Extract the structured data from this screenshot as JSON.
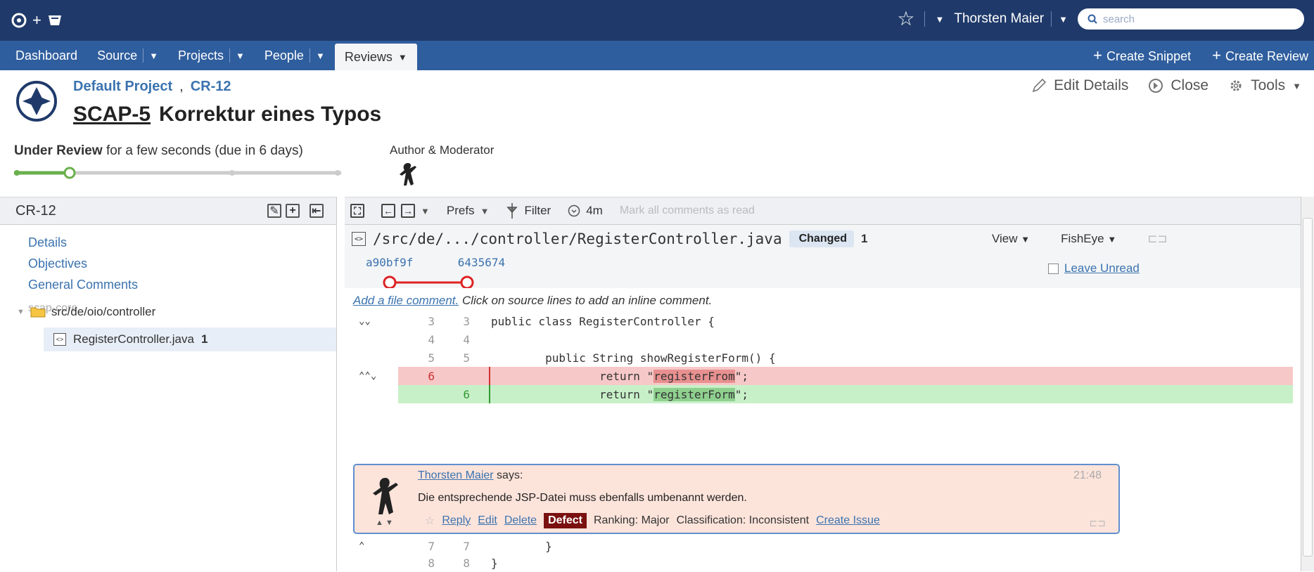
{
  "topbar": {
    "user_name": "Thorsten Maier",
    "search_placeholder": "search"
  },
  "nav": {
    "items": [
      "Dashboard",
      "Source",
      "Projects",
      "People",
      "Reviews"
    ],
    "create_snippet": "Create Snippet",
    "create_review": "Create Review"
  },
  "header": {
    "project": "Default Project",
    "review_id": "CR-12",
    "issue_key": "SCAP-5",
    "title": "Korrektur eines Typos",
    "status": "Under Review",
    "status_detail": "for a few seconds (due in 6 days)",
    "role": "Author & Moderator",
    "actions": [
      "Edit Details",
      "Close",
      "Tools"
    ],
    "progress": 0.17
  },
  "left": {
    "title": "CR-12",
    "links": [
      "Details",
      "Objectives",
      "General Comments"
    ],
    "repo": "scap-core",
    "folder": "src/de/oio/controller",
    "file": "RegisterController.java",
    "file_comments": "1"
  },
  "toolbar": {
    "prefs": "Prefs",
    "filter": "Filter",
    "time": "4m",
    "mark_all": "Mark all comments as read"
  },
  "file": {
    "path": "/src/de/.../controller/RegisterController.java",
    "badge": "Changed",
    "comment_count": "1",
    "rev_from": "a90bf9f",
    "rev_to": "6435674",
    "view": "View",
    "fisheye": "FishEye",
    "leave_unread": "Leave Unread"
  },
  "diff": {
    "hint_link": "Add a file comment.",
    "hint_text": " Click on source lines to add an inline comment.",
    "lines": [
      {
        "l1": "3",
        "l2": "3",
        "text": "public class RegisterController {"
      },
      {
        "l1": "4",
        "l2": "4",
        "text": ""
      },
      {
        "l1": "5",
        "l2": "5",
        "text": "        public String showRegisterForm() {"
      },
      {
        "l1": "6",
        "l2": "",
        "pre": "                return \"",
        "hl": "registerFrom",
        "post": "\";"
      },
      {
        "l1": "",
        "l2": "6",
        "pre": "                return \"",
        "hl": "registerForm",
        "post": "\";"
      },
      {
        "l1": "7",
        "l2": "7",
        "text": "        }"
      },
      {
        "l1": "8",
        "l2": "8",
        "text": "}"
      }
    ]
  },
  "comment": {
    "author": "Thorsten Maier",
    "says": " says:",
    "time": "21:48",
    "text": "Die entsprechende JSP-Datei muss ebenfalls umbenannt werden.",
    "reply": "Reply",
    "edit": "Edit",
    "delete": "Delete",
    "defect": "Defect",
    "ranking": "Ranking: Major",
    "classification": "Classification: Inconsistent",
    "create_issue": "Create Issue"
  },
  "colors": {
    "topbar": "#1f3a6a",
    "navbar": "#2f5e9e",
    "link": "#3b73af",
    "defect": "#7a1010"
  }
}
